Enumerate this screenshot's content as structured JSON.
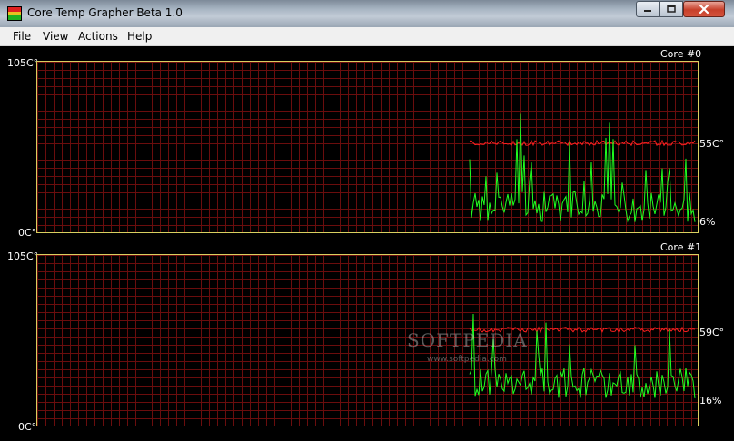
{
  "window": {
    "title": "Core Temp Grapher Beta 1.0",
    "controls": [
      "minimize",
      "maximize",
      "close"
    ]
  },
  "menu": {
    "items": [
      "File",
      "View",
      "Actions",
      "Help"
    ]
  },
  "graphs": [
    {
      "core_label": "Core #0",
      "ymax_label": "105C°",
      "ymin_label": "0C°",
      "temp_label": "55C°",
      "load_label": "6%",
      "temp_value_c": 55,
      "load_value_pct": 6
    },
    {
      "core_label": "Core #1",
      "ymax_label": "105C°",
      "ymin_label": "0C°",
      "temp_label": "59C°",
      "load_label": "16%",
      "temp_value_c": 59,
      "load_value_pct": 16
    }
  ],
  "colors": {
    "temperature_line": "#ff2020",
    "load_line": "#20ff20",
    "grid": "#6a0d0d",
    "plot_border": "#d8d060"
  },
  "watermark": {
    "text": "SOFTPEDIA",
    "sub": "www.softpedia.com"
  }
}
